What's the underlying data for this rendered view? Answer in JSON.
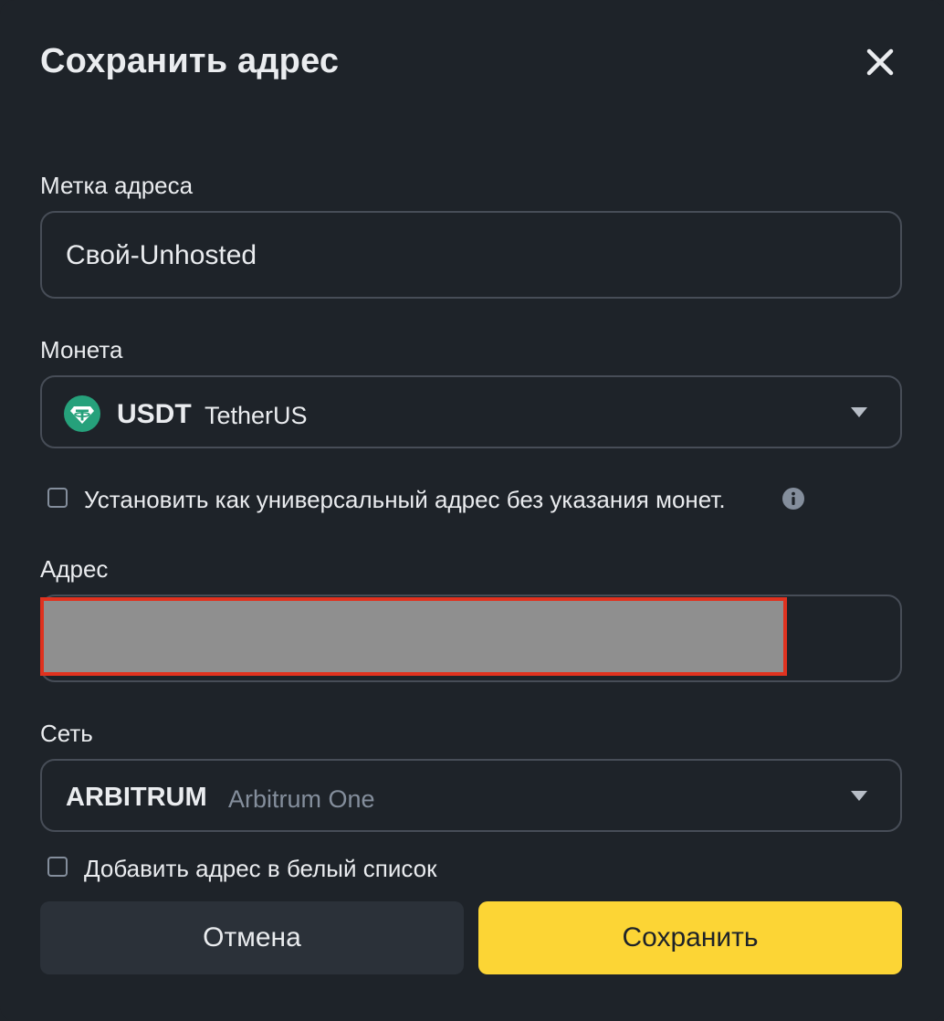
{
  "dialog": {
    "title": "Сохранить адрес",
    "close_icon": "close-icon"
  },
  "label_field": {
    "label": "Метка адреса",
    "value": "Свой-Unhosted"
  },
  "coin_field": {
    "label": "Монета",
    "icon": "tether-icon",
    "symbol": "USDT",
    "name": "TetherUS",
    "caret_icon": "caret-down-icon"
  },
  "universal_checkbox": {
    "label": "Установить как универсальный адрес без указания монет.",
    "checked": false,
    "info_icon": "info-icon"
  },
  "address_field": {
    "label": "Адрес"
  },
  "network_field": {
    "label": "Сеть",
    "network": "ARBITRUM",
    "network_name": "Arbitrum One",
    "caret_icon": "caret-down-icon"
  },
  "whitelist_checkbox": {
    "label": "Добавить адрес в белый список",
    "checked": false
  },
  "buttons": {
    "cancel": "Отмена",
    "save": "Сохранить"
  },
  "colors": {
    "background": "#1e2329",
    "border": "#474d57",
    "accent": "#fcd535",
    "secondary_button": "#2b3139",
    "tether": "#26a17b",
    "redaction": "#8f8f8f",
    "redaction_border": "#e0321f"
  }
}
